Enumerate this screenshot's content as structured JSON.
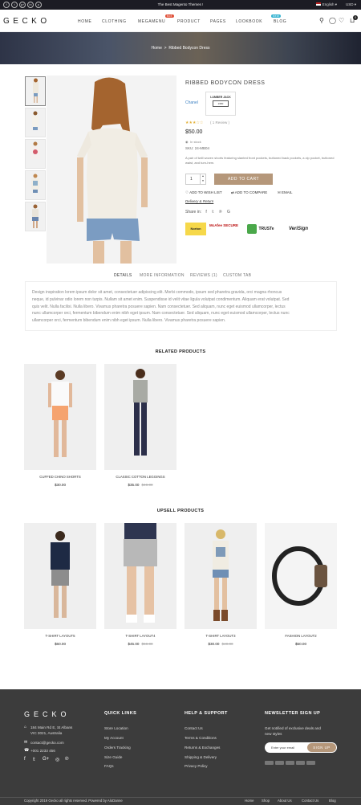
{
  "topbar": {
    "promo": "The Best Magento Themes !",
    "language": "English",
    "currency": "USD",
    "social": [
      "f",
      "t",
      "g+",
      "in",
      "p"
    ]
  },
  "header": {
    "logo": "GECKO",
    "nav": [
      "HOME",
      "CLOTHING",
      "MEGAMENU",
      "PRODUCT",
      "PAGES",
      "LOOKBOOK",
      "BLOG"
    ],
    "badges": {
      "megamenu": "hot",
      "lookbook": "new"
    },
    "cart_count": "0"
  },
  "banner": {
    "breadcrumb_home": "Home",
    "breadcrumb_sep": ">",
    "breadcrumb_current": "Ribbed Bodycon Dress"
  },
  "product": {
    "title": "RIBBED BODYCON DRESS",
    "brand": "Chanel",
    "brand_logo_text": "LUMBER JACK",
    "brand_logo_sub": "1950",
    "stars": "★★★☆☆",
    "reviews": "( 1 Review )",
    "price": "$50.00",
    "stock": "In stock",
    "sku": "SKU: 24-MB04",
    "description": "A pair of twill woven shorts featuring slanted front pockets, buttoned back pockets, a zip pocket, buttoned waist, and turn-hem.",
    "qty": "1",
    "add_to_cart": "ADD TO CART",
    "wishlist": "ADD TO WISH LIST",
    "compare": "ADD TO COMPARE",
    "email": "EMAIL",
    "delivery": "Delivery & Return",
    "share_label": "Share in:",
    "trust": [
      "Norton",
      "McAfee SECURE",
      "TRUSTe",
      "VeriSign"
    ]
  },
  "tabs": {
    "items": [
      "DETAILS",
      "MORE INFORMATION",
      "REVIEWS (1)",
      "CUSTOM TAB"
    ],
    "details_lines": [
      "Design inspiration lorem ipsum dolor sit amet, consectetuer adipiscing elit. Morbi commodo, ipsum sed pharetra gravida, orci magna rhoncus",
      "neque, id pulvinar odio lorem non turpis. Nullam sit amet enim. Suspendisse id velit vitae ligula volutpat condimentum. Aliquam erat volutpat. Sed",
      "quis velit. Nulla facilisi. Nulla libero. Vivamus pharetra posuere sapien. Nam consectetuer. Sed aliquam, nunc eget euismod ullamcorper, lectus",
      "nunc ullamcorper orci, fermentum bibendum enim nibh eget ipsum. Nam consectetuer. Sed aliquam, nunc eget euismod ullamcorper, lectus nunc",
      "ullamcorper orci, fermentum bibendum enim nibh eget ipsum. Nulla libero. Vivamus pharetra posuere sapien."
    ]
  },
  "related": {
    "heading": "RELATED PRODUCTS",
    "items": [
      {
        "name": "CUFFED CHINO SHORTS",
        "price": "$30.00",
        "old": ""
      },
      {
        "name": "CLASSIC COTTON LEGGINGS",
        "price": "$35.00",
        "old": "$40.00"
      }
    ]
  },
  "upsell": {
    "heading": "UPSELL PRODUCTS",
    "items": [
      {
        "name": "T-SHIRT LAYOUT5",
        "price": "$60.00",
        "old": ""
      },
      {
        "name": "T-SHIRT LAYOUT4",
        "price": "$45.00",
        "old": "$50.00"
      },
      {
        "name": "T-SHIRT LAYOUT3",
        "price": "$30.00",
        "old": "$40.00"
      },
      {
        "name": "FASHION LAYOUT2",
        "price": "$50.00",
        "old": ""
      }
    ]
  },
  "footer": {
    "logo": "GECKO",
    "address1": "184 Main Rd E, St Albans",
    "address2": "VIC 3021, Australia",
    "email": "contact@gecko.com",
    "phone": "+001 2233 456",
    "quick_links_heading": "QUICK LINKS",
    "quick_links": [
      "Store Location",
      "My Account",
      "Orders Tracking",
      "Size Guide",
      "FAQs"
    ],
    "help_heading": "HELP & SUPPORT",
    "help_links": [
      "Contact Us",
      "Terms & Conditions",
      "Returns & Exchanges",
      "Shipping & Delivery",
      "Privacy Policy"
    ],
    "newsletter_heading": "NEWSLETTER SIGN UP",
    "newsletter_text1": "Get notified of exclusive deals and",
    "newsletter_text2": "new styles",
    "newsletter_placeholder": "Enter your email",
    "newsletter_button": "SIGN UP",
    "copyright": "Copyright 2019 Gecko all rights reserved. Powered by AloDanne",
    "bottom_links": [
      "Home",
      "Shop",
      "About Us",
      "Contact Us",
      "Blog"
    ]
  },
  "colors": {
    "accent": "#b5977a",
    "footer_bg": "#3c3c3c",
    "topbar_bg": "#1c1c24",
    "link_blue": "#3a7fc1"
  }
}
